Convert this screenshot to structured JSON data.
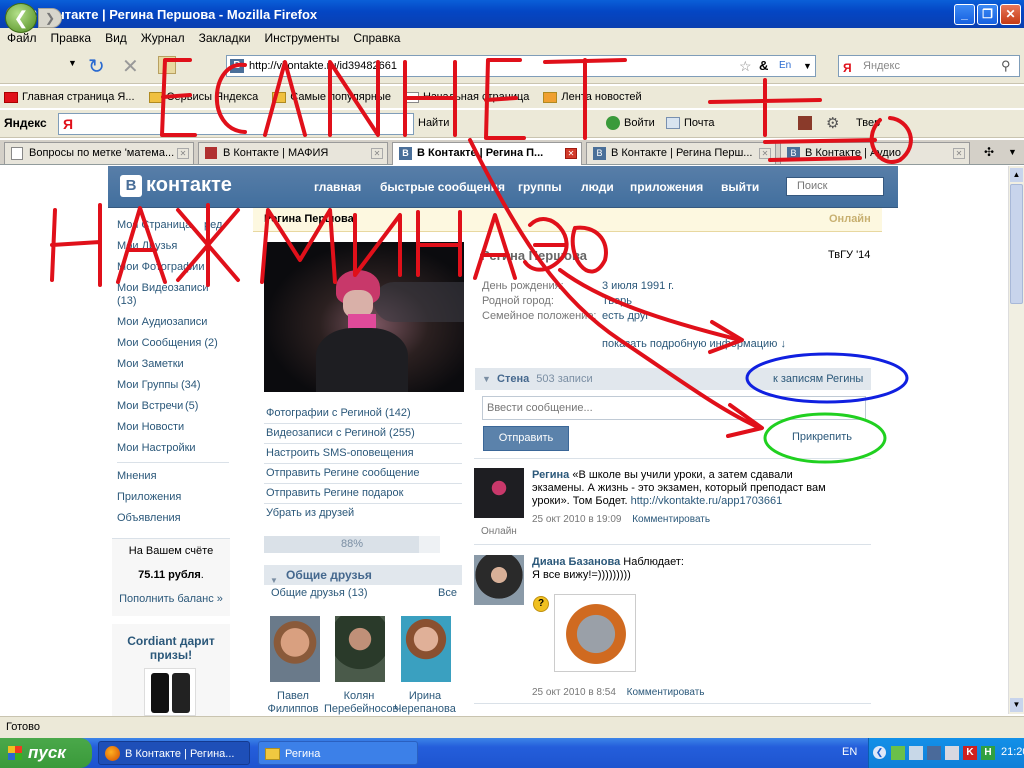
{
  "window": {
    "title": "В Контакте | Регина Першова - Mozilla Firefox"
  },
  "menu": [
    "Файл",
    "Правка",
    "Вид",
    "Журнал",
    "Закладки",
    "Инструменты",
    "Справка"
  ],
  "nav": {
    "url": "http://vkontakte.ru/id39482661",
    "search_placeholder": "Яндекс"
  },
  "bookmarks": [
    "Главная страница Я...",
    "Сервисы Яндекса",
    "Самые популярные",
    "Начальная страница",
    "Лента новостей"
  ],
  "yandex_bar": {
    "label": "Яндекс",
    "find": "Найти",
    "login": "Войти",
    "mail": "Почта",
    "weather": "Твер"
  },
  "tabs": [
    {
      "label": "Вопросы по метке 'матема..."
    },
    {
      "label": "В Контакте | МАФИЯ"
    },
    {
      "label": "В Контакте | Регина П..."
    },
    {
      "label": "В Контакте | Регина Перш..."
    },
    {
      "label": "В Контакте | Аудио"
    }
  ],
  "vk": {
    "logo": "контакте",
    "logo_letter": "B",
    "nav": [
      "главная",
      "быстрые сообщения",
      "группы",
      "люди",
      "приложения",
      "выйти"
    ],
    "search_placeholder": "Поиск",
    "left_menu": [
      "Моя Страница",
      "Мои Друзья",
      "Мои Фотографии",
      "Мои Видеозаписи",
      "(13)",
      "Мои Аудиозаписи",
      "Мои Сообщения (2)",
      "Мои Заметки",
      "Мои Группы",
      "(34)",
      "Мои Встречи",
      "(5)",
      "Мои Новости",
      "Мои Настройки"
    ],
    "left_menu_edit": "ред.",
    "left_menu_extra": [
      "Мнения",
      "Приложения",
      "Объявления"
    ],
    "balance": {
      "label": "На Вашем счёте",
      "amount": "75.11 рубля",
      "amount_dot": ".",
      "topup": "Пополнить баланс »"
    },
    "promo": {
      "title": "Cordiant дарит призы!"
    },
    "profile": {
      "name": "Регина Першова",
      "status": "Онлайн",
      "display_name": "Регина Першова",
      "school": "ТвГУ '14",
      "info": [
        {
          "label": "День рождения:",
          "value": "3 июля 1991 г."
        },
        {
          "label": "Родной город:",
          "value": "Тверь"
        },
        {
          "label": "Семейное положение:",
          "value": "есть друг"
        }
      ],
      "more_info": "показать подробную информацию ↓"
    },
    "profile_links": [
      "Фотографии с Региной (142)",
      "Видеозаписи с Региной (255)",
      "Настроить SMS-оповещения",
      "Отправить Регине сообщение",
      "Отправить Регине подарок",
      "Убрать из друзей"
    ],
    "progress": {
      "text": "88%",
      "value": 88
    },
    "friends": {
      "header": "Общие друзья",
      "count_label": "Общие друзья (13)",
      "all": "Все",
      "items": [
        {
          "first": "Павел",
          "last": "Филиппов"
        },
        {
          "first": "Колян",
          "last": "Перебейносов"
        },
        {
          "first": "Ирина",
          "last": "Черепанова"
        }
      ]
    },
    "wall": {
      "title": "Стена",
      "count": "503 записи",
      "to_posts": "к записям Регины",
      "input_placeholder": "Ввести сообщение...",
      "send": "Отправить",
      "attach": "Прикрепить",
      "posts": [
        {
          "author": "Регина",
          "text": "«В школе вы учили уроки, а затем сдавали экзамены. А жизнь - это экзамен, который преподаст вам уроки». Том Бодет.",
          "link": "http://vkontakte.ru/app1703661",
          "date": "25 окт 2010 в 19:09",
          "comment": "Комментировать",
          "online": "Онлайн"
        },
        {
          "author": "Диана Базанова",
          "action": "Наблюдает:",
          "text": "Я все вижу!=)))))))))",
          "date": "25 окт 2010 в 8:54",
          "comment": "Комментировать"
        }
      ]
    }
  },
  "statusbar": {
    "text": "Готово"
  },
  "taskbar": {
    "start": "пуск",
    "items": [
      "В Контакте | Регина...",
      "Регина"
    ],
    "lang": "EN",
    "time": "21:20"
  },
  "annotations": [
    "ЕСЛИ НЕТ",
    "НАЖМИ НА ЭТО"
  ],
  "colors": {
    "vk_blue": "#4a6f99",
    "link": "#2b587a",
    "annot_red": "#e0101a",
    "annot_blue": "#1020e0",
    "annot_green": "#20d020"
  }
}
